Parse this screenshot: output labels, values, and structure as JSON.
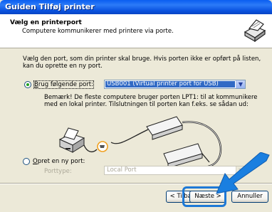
{
  "window": {
    "title": "Guiden Tilføj printer"
  },
  "header": {
    "title": "Vælg en printerport",
    "subtitle": "Computere kommunikerer med printere via porte."
  },
  "intro": "Vælg den port, som din printer skal bruge. Hvis porten ikke er opført på listen, kan du oprette en ny port.",
  "use_port": {
    "label_prefix": "B",
    "label_rest": "rug følgende port:",
    "selected": "USB001 (Virtual printer port for USB)"
  },
  "note": "Bemærk! De fleste computere bruger porten LPT1: til at kommunikere med en lokal printer. Tilslutningen til porten kan f.eks. se sådan ud:",
  "new_port": {
    "label_prefix": "O",
    "label_rest": "pret en ny port:",
    "type_label": "Porttype:",
    "type_value": "Local Port"
  },
  "buttons": {
    "back": "< Tilbage",
    "next": "Næste >",
    "cancel": "Annuller"
  },
  "colors": {
    "accent": "#1e79d6",
    "selection": "#316ac5",
    "titlebar": "#0a5ef0"
  },
  "icons": [
    "printer-icon",
    "computer-illustration",
    "parallel-cable-illustration",
    "pointer-arrow-icon"
  ]
}
